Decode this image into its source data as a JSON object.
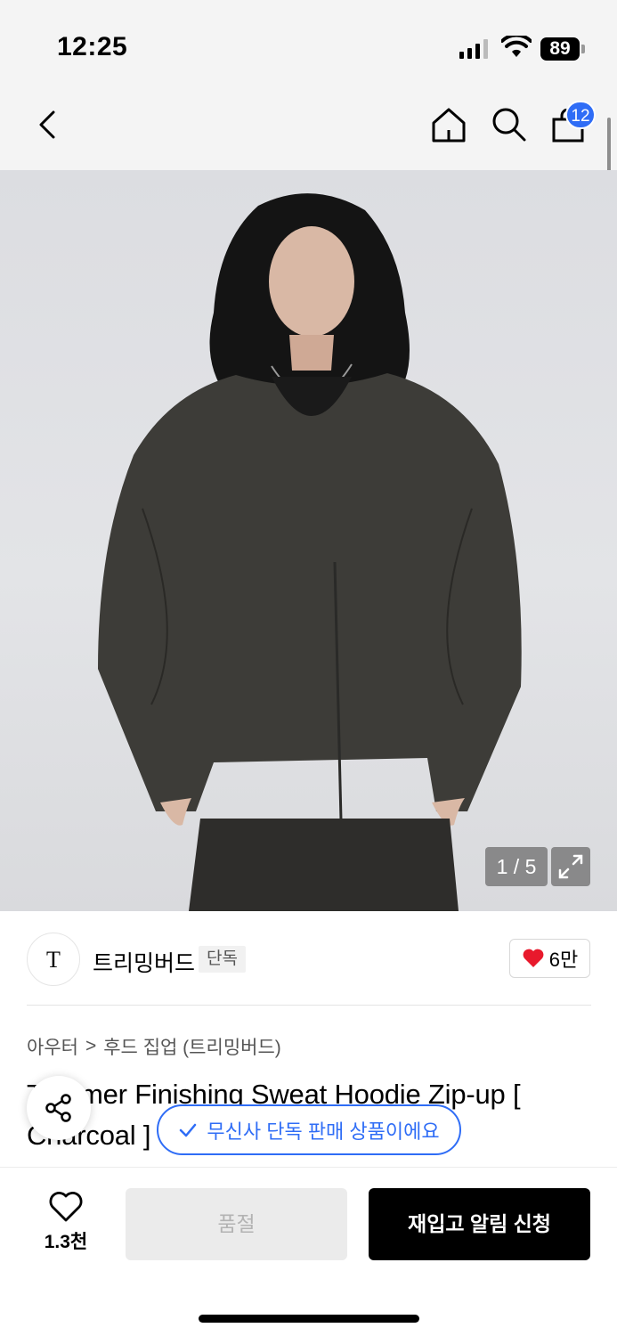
{
  "status_bar": {
    "time": "12:25",
    "battery": "89"
  },
  "nav": {
    "cart_count": "12"
  },
  "gallery": {
    "counter": "1 / 5"
  },
  "brand": {
    "logo_text": "T",
    "name": "트리밍버드",
    "badge": "단독",
    "likes": "6만"
  },
  "breadcrumb": {
    "category": "아우터",
    "separator": ">",
    "subcategory": "후드 집업 (트리밍버드)"
  },
  "product": {
    "title": "Trimmer Finishing Sweat Hoodie Zip-up [ Charcoal ]"
  },
  "toast": {
    "text": "무신사 단독 판매 상품이에요"
  },
  "bottom": {
    "wish_count": "1.3천",
    "soldout_label": "품절",
    "restock_label": "재입고 알림 신청"
  },
  "colors": {
    "accent": "#2f6df6",
    "like_red": "#e8192c"
  },
  "icons": [
    "back-icon",
    "home-icon",
    "search-icon",
    "shopping-bag-icon",
    "expand-icon",
    "heart-icon",
    "share-icon",
    "check-icon"
  ]
}
